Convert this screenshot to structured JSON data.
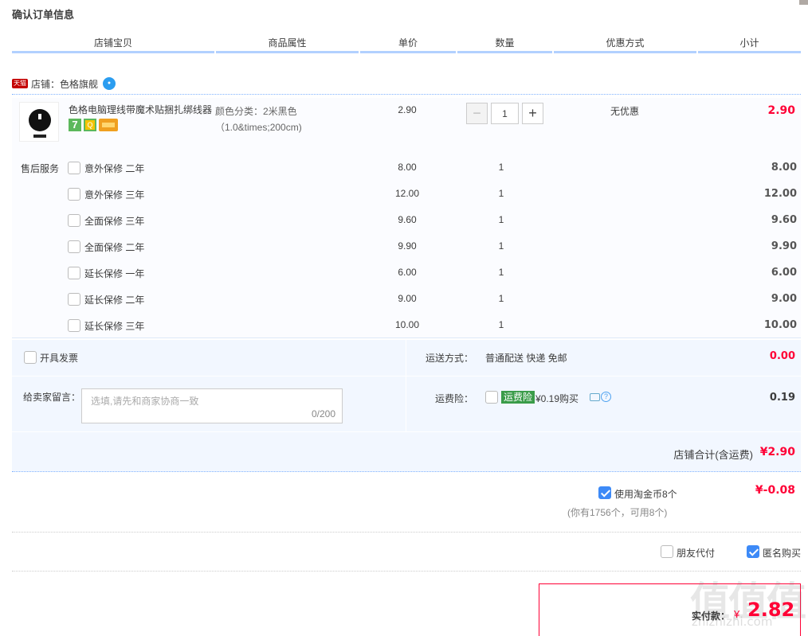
{
  "page_title": "确认订单信息",
  "table_headers": [
    "店铺宝贝",
    "商品属性",
    "单价",
    "数量",
    "优惠方式",
    "小计"
  ],
  "shop": {
    "tag": "天猫",
    "label": "店铺：",
    "name": "色格旗舰"
  },
  "product": {
    "name": "色格电脑理线带魔术贴捆扎绑线器",
    "attr": "颜色分类：2米黑色（1.0&times;200cm)",
    "unit_price": "2.90",
    "quantity": "1",
    "promo": "无优惠",
    "subtotal": "2.90",
    "badge_seven": "7",
    "badge_q": "Q"
  },
  "after_sales": {
    "label": "售后服务",
    "items": [
      {
        "name": "意外保修 二年",
        "price": "8.00",
        "qty": "1",
        "subtotal": "8.00"
      },
      {
        "name": "意外保修 三年",
        "price": "12.00",
        "qty": "1",
        "subtotal": "12.00"
      },
      {
        "name": "全面保修 三年",
        "price": "9.60",
        "qty": "1",
        "subtotal": "9.60"
      },
      {
        "name": "全面保修 二年",
        "price": "9.90",
        "qty": "1",
        "subtotal": "9.90"
      },
      {
        "name": "延长保修 一年",
        "price": "6.00",
        "qty": "1",
        "subtotal": "6.00"
      },
      {
        "name": "延长保修 二年",
        "price": "9.00",
        "qty": "1",
        "subtotal": "9.00"
      },
      {
        "name": "延长保修 三年",
        "price": "10.00",
        "qty": "1",
        "subtotal": "10.00"
      }
    ]
  },
  "invoice": {
    "label": "开具发票"
  },
  "shipping": {
    "label": "运送方式：",
    "value": "普通配送 快递 免邮",
    "price": "0.00"
  },
  "message": {
    "label": "给卖家留言：",
    "placeholder": "选填,请先和商家协商一致",
    "counter": "0/200"
  },
  "insurance": {
    "label": "运费险：",
    "tag": "运费险",
    "value": "¥0.19购买",
    "price": "0.19",
    "help": "?"
  },
  "shop_total": {
    "label": "店铺合计(含运费)",
    "value": "¥2.90"
  },
  "coins": {
    "label": "使用淘金币8个",
    "value": "¥-0.08",
    "note": "(你有1756个，可用8个)"
  },
  "friend_pay": {
    "label": "朋友代付"
  },
  "anonymous": {
    "label": "匿名购买"
  },
  "pay": {
    "label": "实付款：",
    "currency": "¥",
    "value": "2.82"
  },
  "watermark": {
    "main": "值值值",
    "sub": "zhizhizhi.com"
  },
  "colors": {
    "accent_red": "#ff0036",
    "header_line": "#b2d1ff",
    "check_blue": "#3d8af7"
  }
}
